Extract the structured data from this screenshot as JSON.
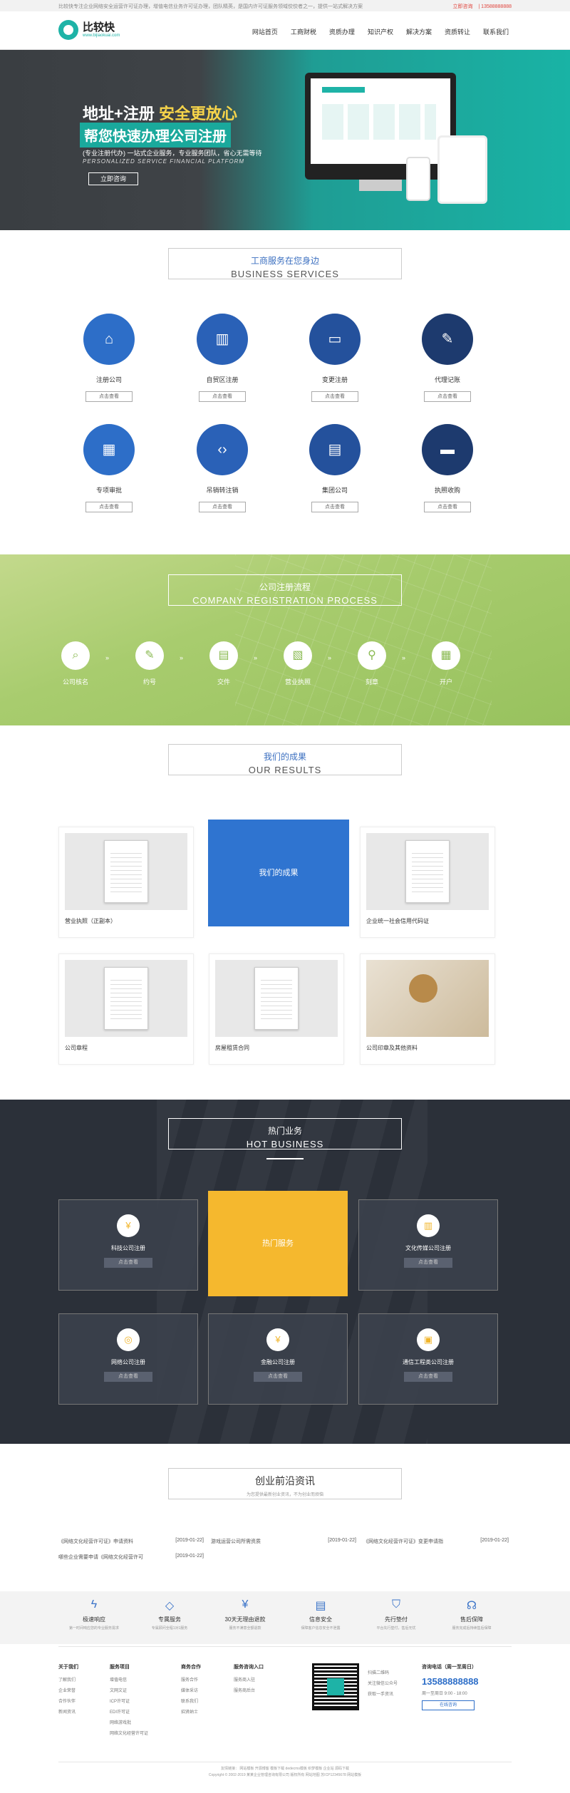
{
  "topbar": {
    "notice": "比较快专注企业网络安全运营许可证办理，增值电信业务许可证办理，团队精英，是国内许可证服务领域佼佼者之一，提供一站式解决方案",
    "links": [
      "立即咨询",
      "| 13588888888"
    ]
  },
  "header": {
    "logo_name": "比较快",
    "logo_url": "www.bijiaokuai.com",
    "nav": [
      "网站首页",
      "工商财税",
      "资质办理",
      "知识产权",
      "解决方案",
      "资质转让",
      "联系我们"
    ]
  },
  "hero": {
    "title_white": "地址+注册",
    "title_yellow": "安全更放心",
    "subtitle": "帮您快速办理公司注册",
    "line1": "(专业注册代办) 一站式企业服务，专业服务团队，省心无需等待",
    "line2": "PERSONALIZED SERVICE FINANCIAL PLATFORM",
    "button": "立即咨询"
  },
  "services": {
    "title_cn": "工商服务在您身边",
    "title_en": "BUSINESS SERVICES",
    "more": "点击查看",
    "items": [
      {
        "name": "注册公司",
        "icon": "home-icon",
        "glyph": "⌂",
        "color": "#2d6ec8"
      },
      {
        "name": "自贸区注册",
        "icon": "book-icon",
        "glyph": "▥",
        "color": "#2a61b7"
      },
      {
        "name": "变更注册",
        "icon": "monitor-icon",
        "glyph": "▭",
        "color": "#24519c"
      },
      {
        "name": "代理记账",
        "icon": "pencil-icon",
        "glyph": "✎",
        "color": "#1d3a6e"
      },
      {
        "name": "专项审批",
        "icon": "calendar-icon",
        "glyph": "▦",
        "color": "#2d6ec8"
      },
      {
        "name": "吊销转注销",
        "icon": "code-icon",
        "glyph": "‹›",
        "color": "#2a61b7"
      },
      {
        "name": "集团公司",
        "icon": "folder-icon",
        "glyph": "▤",
        "color": "#24519c"
      },
      {
        "name": "执照收购",
        "icon": "card-icon",
        "glyph": "▬",
        "color": "#1d3a6e"
      }
    ]
  },
  "process": {
    "title_cn": "公司注册流程",
    "title_en": "COMPANY REGISTRATION PROCESS",
    "arrow": "»",
    "steps": [
      {
        "label": "公司核名",
        "icon": "search-icon",
        "glyph": "⌕"
      },
      {
        "label": "约号",
        "icon": "pen-icon",
        "glyph": "✎"
      },
      {
        "label": "交件",
        "icon": "document-icon",
        "glyph": "▤"
      },
      {
        "label": "营业执照",
        "icon": "file-icon",
        "glyph": "▧"
      },
      {
        "label": "刻章",
        "icon": "stamp-icon",
        "glyph": "⚲"
      },
      {
        "label": "开户",
        "icon": "bank-calendar-icon",
        "glyph": "▦"
      }
    ]
  },
  "results": {
    "title_cn": "我们的成果",
    "title_en": "OUR RESULTS",
    "highlight": "我们的成果",
    "cards": [
      "营业执照（正副本）",
      "企业统一社会信用代码证",
      "公司章程",
      "房屋租赁合同",
      "公司印章及其他资料"
    ]
  },
  "hot": {
    "title_cn": "热门业务",
    "title_en": "HOT BUSINESS",
    "highlight": "热门服务",
    "more": "点击查看",
    "items": [
      {
        "name": "科技公司注册",
        "icon": "yen-icon",
        "glyph": "¥"
      },
      {
        "name": "文化传媒公司注册",
        "icon": "building-icon",
        "glyph": "▥"
      },
      {
        "name": "网络公司注册",
        "icon": "globe-icon",
        "glyph": "◎"
      },
      {
        "name": "金融公司注册",
        "icon": "moneybag-icon",
        "glyph": "¥"
      },
      {
        "name": "通信工程类公司注册",
        "icon": "bag-icon",
        "glyph": "▣"
      }
    ]
  },
  "news": {
    "title": "创业前沿资讯",
    "subtitle": "为您提供最新创业资讯，不为创业而烦恼",
    "items": [
      {
        "title": "《网络文化经营许可证》申请资料",
        "date": "[2019-01-22]"
      },
      {
        "title": "游戏运营公司所需资质",
        "date": "[2019-01-22]"
      },
      {
        "title": "《网络文化经营许可证》变更申请指",
        "date": "[2019-01-22]"
      },
      {
        "title": "哪些企业需要申请《网络文化经营许可",
        "date": "[2019-01-22]"
      }
    ]
  },
  "features": [
    {
      "title": "极速响应",
      "sub": "第一时间响应您的专业服务需求",
      "icon": "lightning-icon",
      "glyph": "ϟ"
    },
    {
      "title": "专属服务",
      "sub": "专属顾问全程1对1服务",
      "icon": "diamond-icon",
      "glyph": "◇"
    },
    {
      "title": "30天无理由退款",
      "sub": "服务不满意全额退款",
      "icon": "yen-circle-icon",
      "glyph": "¥"
    },
    {
      "title": "信息安全",
      "sub": "保障客户信息安全不泄露",
      "icon": "doc-shield-icon",
      "glyph": "▤"
    },
    {
      "title": "先行垫付",
      "sub": "平台先行垫付，售后无忧",
      "icon": "shield-icon",
      "glyph": "⛉"
    },
    {
      "title": "售后保障",
      "sub": "服务完成后持续售后保障",
      "icon": "headset-icon",
      "glyph": "☊"
    }
  ],
  "footer": {
    "cols": [
      {
        "head": "关于我们",
        "items": [
          "了解我们",
          "企业荣誉",
          "合作伙伴",
          "新闻资讯"
        ]
      },
      {
        "head": "服务项目",
        "items": [
          "增值电信",
          "文网文证",
          "ICP许可证",
          "EDI许可证",
          "网络游戏批",
          "网络文化经营许可证"
        ]
      },
      {
        "head": "商务合作",
        "items": [
          "服务合作",
          "媒体采访",
          "联系我们",
          "招贤纳士"
        ]
      },
      {
        "head": "服务咨询入口",
        "items": [
          "服务商入驻",
          "服务商后台"
        ]
      }
    ],
    "qr_lines": [
      "扫描二维码",
      "关注微信公众号",
      "获取一手资讯"
    ],
    "hotline_label": "咨询电话（周一至周日）",
    "hotline": "13588888888",
    "hours": "周一至周日 9:00 - 18:00",
    "online_btn": "在线咨询",
    "bottom1": "友情链接：  网站模板  开源博客  模板下载  dedecms模板  织梦模板  企业站  源码下载",
    "bottom2": "Copyright © 2002-2019 某某企业管理咨询有限公司 版权所有    网站地图  苏ICP12345678  网站模板"
  }
}
